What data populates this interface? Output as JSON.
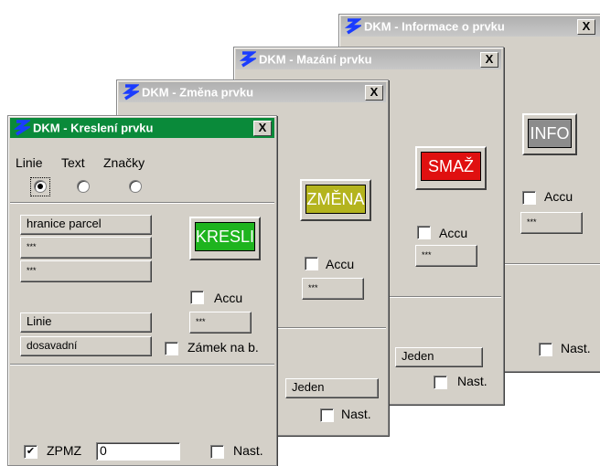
{
  "windows": {
    "info": {
      "title": "DKM - Informace o prvku",
      "close": "X",
      "action_button": "INFO",
      "action_color": "#8c8c8c",
      "accu_label": "Accu",
      "value_button": "***",
      "mode_button": "",
      "nast_label": "Nast."
    },
    "mazani": {
      "title": "DKM - Mazání prvku",
      "close": "X",
      "action_button": "SMAŽ",
      "action_color": "#e01010",
      "accu_label": "Accu",
      "value_button": "***",
      "mode_button": "Jeden",
      "nast_label": "Nast."
    },
    "zmena": {
      "title": "DKM - Změna prvku",
      "close": "X",
      "action_button": "ZMĚNA",
      "action_color": "#b4b41e",
      "accu_label": "Accu",
      "value_button": "***",
      "mode_button": "Jeden",
      "nast_label": "Nast."
    },
    "kresleni": {
      "title": "DKM - Kreslení prvku",
      "close": "X",
      "radio_labels": [
        "Linie",
        "Text",
        "Značky"
      ],
      "radio_selected": 0,
      "list_buttons": [
        "hranice parcel",
        "***",
        "***"
      ],
      "action_button": "KRESLI",
      "action_color": "#1eb41e",
      "accu_label": "Accu",
      "value_button": "***",
      "linie_button": "Linie",
      "dosavadni_button": "dosavadní",
      "zamek_label": "Zámek na b.",
      "zpmz_label": "ZPMZ",
      "zpmz_value": "0",
      "zpmz_checked": true,
      "nast_label": "Nast."
    }
  },
  "colors": {
    "active_title": "#0a8a3a",
    "inactive_title": "#b8b8b8",
    "face": "#d4d0c8"
  }
}
